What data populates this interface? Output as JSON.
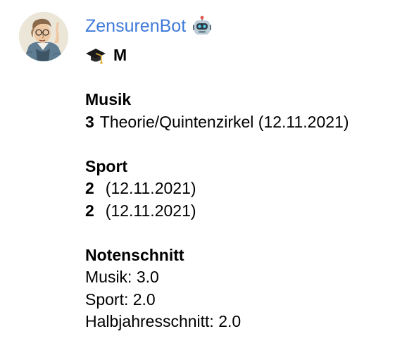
{
  "message": {
    "sender": "ZensurenBot",
    "sender_icon": "robot-face-icon",
    "header_icon": "graduation-cap-icon",
    "header_text": "M",
    "subjects": [
      {
        "name": "Musik",
        "entries": [
          {
            "grade": "3",
            "text": "Theorie/Quintenzirkel (12.11.2021)"
          }
        ]
      },
      {
        "name": "Sport",
        "entries": [
          {
            "grade": "2",
            "text": "(12.11.2021)"
          },
          {
            "grade": "2",
            "text": "(12.11.2021)"
          }
        ]
      }
    ],
    "summary": {
      "title": "Notenschnitt",
      "lines": [
        "Musik: 3.0",
        "Sport: 2.0",
        "Halbjahresschnitt: 2.0"
      ]
    }
  },
  "colors": {
    "sender_name": "#3f7ad9",
    "text": "#000000",
    "background": "#ffffff"
  }
}
